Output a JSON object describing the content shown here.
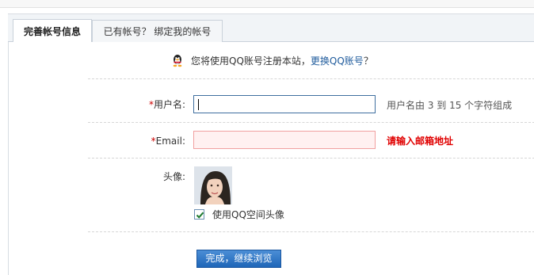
{
  "tabs": [
    {
      "label": "完善帐号信息",
      "active": true
    },
    {
      "label": "已有帐号？ 绑定我的帐号",
      "active": false
    }
  ],
  "notice": {
    "text": "您将使用QQ账号注册本站，",
    "link": "更换QQ账号",
    "suffix": "？",
    "icon": "qq-penguin-icon"
  },
  "form": {
    "username": {
      "required_mark": "*",
      "label": "用户名:",
      "value": "",
      "hint": "用户名由 3 到 15 个字符组成"
    },
    "email": {
      "required_mark": "*",
      "label": "Email:",
      "value": "",
      "error": "请输入邮箱地址"
    },
    "avatar": {
      "label": "头像:",
      "checkbox_label": "使用QQ空间头像",
      "checked": true
    },
    "submit_label": "完成，继续浏览"
  },
  "colors": {
    "link": "#1f5b9c",
    "error": "#e00000",
    "button": "#2a72c4",
    "required": "#cc0000"
  }
}
